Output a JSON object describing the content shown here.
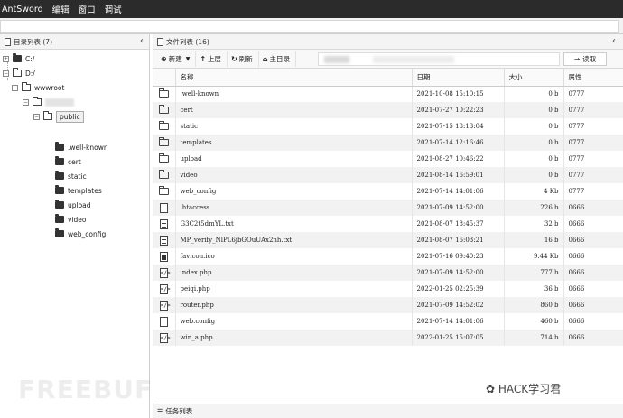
{
  "menubar": {
    "app_name": "AntSword",
    "items": [
      "编辑",
      "窗口",
      "调试"
    ]
  },
  "left_panel": {
    "title": "目录列表 (7)",
    "collapse_glyph": "‹",
    "tree": {
      "c_drive": "C:/",
      "d_drive": "D:/",
      "wwwroot": "wwwroot",
      "public": "public",
      "children": [
        ".well-known",
        "cert",
        "static",
        "templates",
        "upload",
        "video",
        "web_config"
      ]
    }
  },
  "right_panel": {
    "title": "文件列表 (16)",
    "collapse_glyph": "‹",
    "toolbar": {
      "new_label": "新建",
      "up_label": "上层",
      "refresh_label": "刷新",
      "home_label": "主目录",
      "read_label": "读取"
    },
    "columns": [
      "名称",
      "日期",
      "大小",
      "属性"
    ],
    "files": [
      {
        "type": "folder",
        "name": ".well-known",
        "date": "2021-10-08 15:10:15",
        "size": "0 b",
        "attr": "0777"
      },
      {
        "type": "folder",
        "name": "cert",
        "date": "2021-07-27 10:22:23",
        "size": "0 b",
        "attr": "0777"
      },
      {
        "type": "folder",
        "name": "static",
        "date": "2021-07-15 18:13:04",
        "size": "0 b",
        "attr": "0777"
      },
      {
        "type": "folder",
        "name": "templates",
        "date": "2021-07-14 12:16:46",
        "size": "0 b",
        "attr": "0777"
      },
      {
        "type": "folder",
        "name": "upload",
        "date": "2021-08-27 10:46:22",
        "size": "0 b",
        "attr": "0777"
      },
      {
        "type": "folder",
        "name": "video",
        "date": "2021-08-14 16:59:01",
        "size": "0 b",
        "attr": "0777"
      },
      {
        "type": "folder",
        "name": "web_config",
        "date": "2021-07-14 14:01:06",
        "size": "4 Kb",
        "attr": "0777"
      },
      {
        "type": "file",
        "name": ".htaccess",
        "date": "2021-07-09 14:52:00",
        "size": "226 b",
        "attr": "0666"
      },
      {
        "type": "text",
        "name": "G3C2t5dmYL.txt",
        "date": "2021-08-07 18:45:37",
        "size": "32 b",
        "attr": "0666"
      },
      {
        "type": "text",
        "name": "MP_verify_NlPL6jbGOuUAx2nh.txt",
        "date": "2021-08-07 16:03:21",
        "size": "16 b",
        "attr": "0666"
      },
      {
        "type": "image",
        "name": "favicon.ico",
        "date": "2021-07-16 09:40:23",
        "size": "9.44 Kb",
        "attr": "0666"
      },
      {
        "type": "code",
        "name": "index.php",
        "date": "2021-07-09 14:52:00",
        "size": "777 b",
        "attr": "0666"
      },
      {
        "type": "code",
        "name": "peiqi.php",
        "date": "2022-01-25 02:25:39",
        "size": "36 b",
        "attr": "0666"
      },
      {
        "type": "code",
        "name": "router.php",
        "date": "2021-07-09 14:52:02",
        "size": "860 b",
        "attr": "0666"
      },
      {
        "type": "file",
        "name": "web.config",
        "date": "2021-07-14 14:01:06",
        "size": "460 b",
        "attr": "0666"
      },
      {
        "type": "code",
        "name": "win_a.php",
        "date": "2022-01-25 15:07:05",
        "size": "714 b",
        "attr": "0666"
      }
    ]
  },
  "taskbar": {
    "label": "任务列表"
  },
  "watermarks": {
    "left": "FREEBUF",
    "right": "HACK学习君"
  }
}
